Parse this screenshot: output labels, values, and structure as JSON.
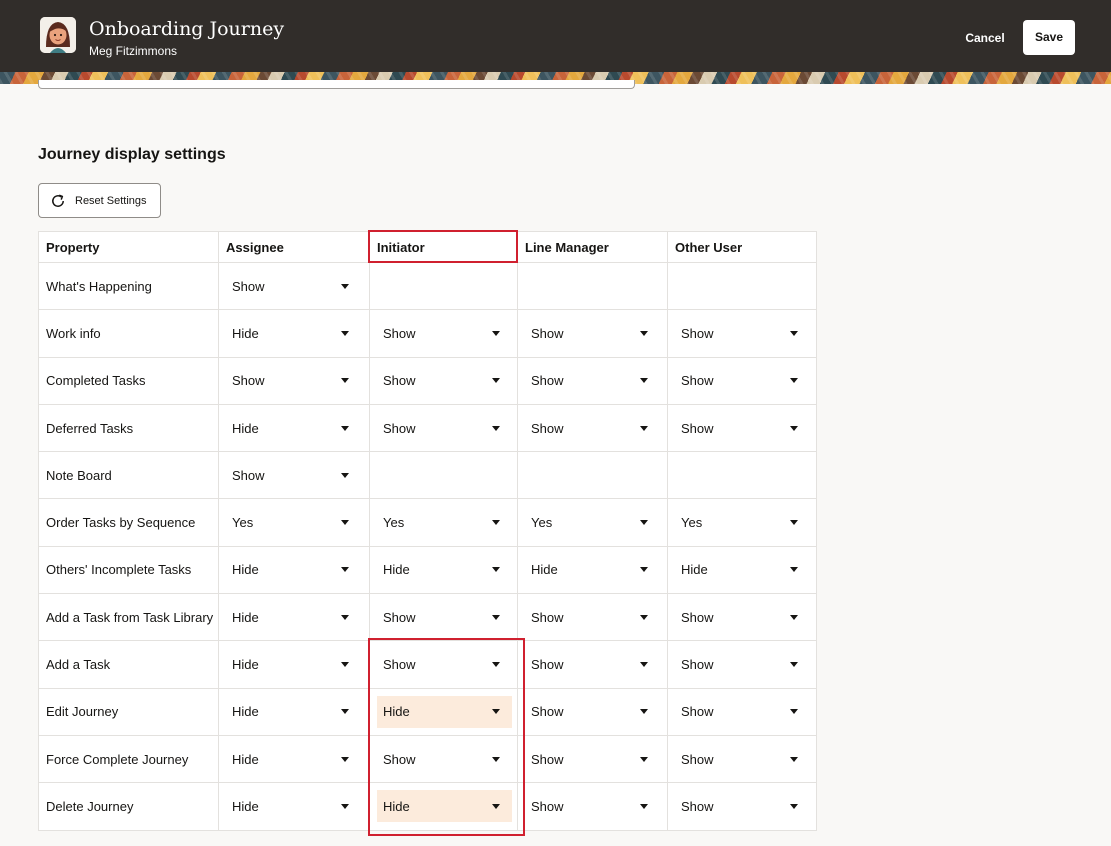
{
  "header": {
    "title": "Onboarding Journey",
    "subtitle": "Meg Fitzimmons",
    "cancel_label": "Cancel",
    "save_label": "Save"
  },
  "section": {
    "title": "Journey display settings",
    "reset_label": "Reset Settings"
  },
  "table": {
    "columns": [
      "Property",
      "Assignee",
      "Initiator",
      "Line Manager",
      "Other User"
    ],
    "rows": [
      {
        "property": "What's Happening",
        "values": [
          "Show",
          "",
          "",
          ""
        ]
      },
      {
        "property": "Work info",
        "values": [
          "Hide",
          "Show",
          "Show",
          "Show"
        ]
      },
      {
        "property": "Completed Tasks",
        "values": [
          "Show",
          "Show",
          "Show",
          "Show"
        ]
      },
      {
        "property": "Deferred Tasks",
        "values": [
          "Hide",
          "Show",
          "Show",
          "Show"
        ]
      },
      {
        "property": "Note Board",
        "values": [
          "Show",
          "",
          "",
          ""
        ]
      },
      {
        "property": "Order Tasks by Sequence",
        "values": [
          "Yes",
          "Yes",
          "Yes",
          "Yes"
        ]
      },
      {
        "property": "Others' Incomplete Tasks",
        "values": [
          "Hide",
          "Hide",
          "Hide",
          "Hide"
        ]
      },
      {
        "property": "Add a Task from Task Library",
        "values": [
          "Hide",
          "Show",
          "Show",
          "Show"
        ]
      },
      {
        "property": "Add a Task",
        "values": [
          "Hide",
          "Show",
          "Show",
          "Show"
        ]
      },
      {
        "property": "Edit Journey",
        "values": [
          "Hide",
          "Hide",
          "Show",
          "Show"
        ]
      },
      {
        "property": "Force Complete Journey",
        "values": [
          "Hide",
          "Show",
          "Show",
          "Show"
        ]
      },
      {
        "property": "Delete Journey",
        "values": [
          "Hide",
          "Hide",
          "Show",
          "Show"
        ]
      }
    ]
  },
  "icons": {
    "reset": "refresh-icon",
    "dropdown": "chevron-down-icon"
  },
  "colors": {
    "header_bg": "#312d2a",
    "changed_cell_bg": "#fcebdc",
    "highlight_border": "#d0202f"
  }
}
